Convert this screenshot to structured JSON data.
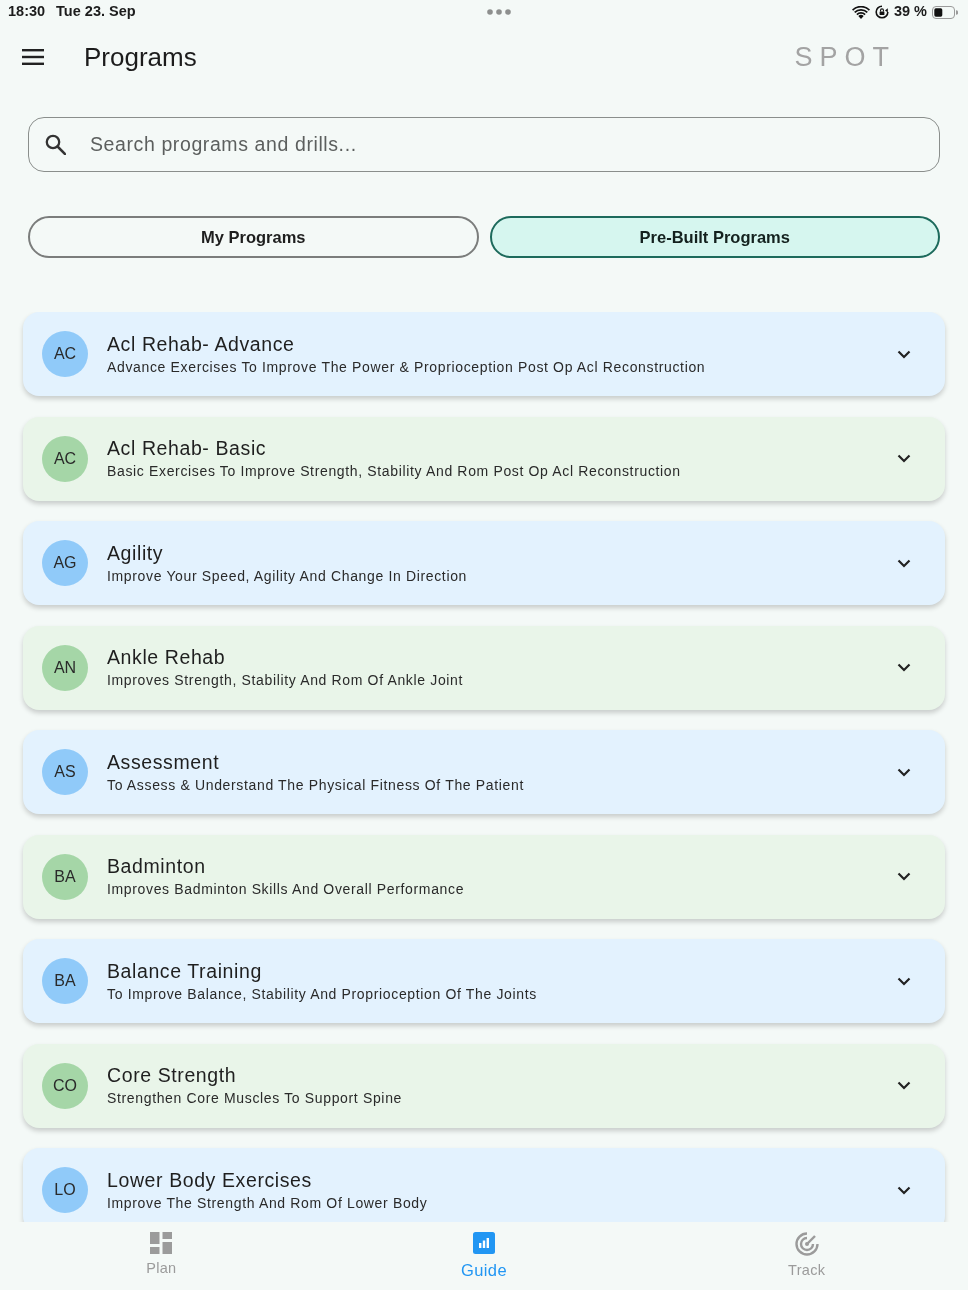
{
  "status_bar": {
    "time": "18:30",
    "date": "Tue 23. Sep",
    "battery": "39 %"
  },
  "header": {
    "title": "Programs",
    "logo": "SPOT"
  },
  "search": {
    "placeholder": "Search programs and drills..."
  },
  "tabs": [
    {
      "label": "My Programs",
      "selected": false
    },
    {
      "label": "Pre-Built Programs",
      "selected": true
    }
  ],
  "programs": [
    {
      "initials": "AC",
      "title": "Acl Rehab- Advance",
      "description": "Advance Exercises To Improve The Power & Proprioception Post Op Acl Reconstruction",
      "color": "#90caf9",
      "expanded": false
    },
    {
      "initials": "AC",
      "title": "Acl Rehab- Basic",
      "description": "Basic Exercises To Improve Strength, Stability And Rom Post Op Acl Reconstruction",
      "color": "#a5d6a7",
      "expanded": false
    },
    {
      "initials": "AG",
      "title": "Agility",
      "description": "Improve Your Speed, Agility And Change In Direction",
      "color": "#90caf9",
      "expanded": false
    },
    {
      "initials": "AN",
      "title": "Ankle Rehab",
      "description": "Improves Strength, Stability And Rom Of Ankle Joint",
      "color": "#a5d6a7",
      "expanded": false
    },
    {
      "initials": "AS",
      "title": "Assessment",
      "description": "To Assess & Understand The Physical Fitness Of The Patient",
      "color": "#90caf9",
      "expanded": false
    },
    {
      "initials": "BA",
      "title": "Badminton",
      "description": "Improves Badminton Skills And Overall Performance",
      "color": "#a5d6a7",
      "expanded": false
    },
    {
      "initials": "BA",
      "title": "Balance Training",
      "description": "To Improve Balance, Stability And Proprioception Of The Joints",
      "color": "#90caf9",
      "expanded": false
    },
    {
      "initials": "CO",
      "title": "Core Strength",
      "description": "Strengthen Core Muscles To Support Spine",
      "color": "#a5d6a7",
      "expanded": false
    },
    {
      "initials": "LO",
      "title": "Lower Body Exercises",
      "description": "Improve The Strength And Rom Of Lower Body",
      "color": "#90caf9",
      "expanded": false
    }
  ],
  "bottom_nav": [
    {
      "label": "Plan",
      "kind": "grid",
      "selected": false
    },
    {
      "label": "Guide",
      "kind": "chart",
      "selected": true
    },
    {
      "label": "Track",
      "kind": "target",
      "selected": false
    }
  ]
}
